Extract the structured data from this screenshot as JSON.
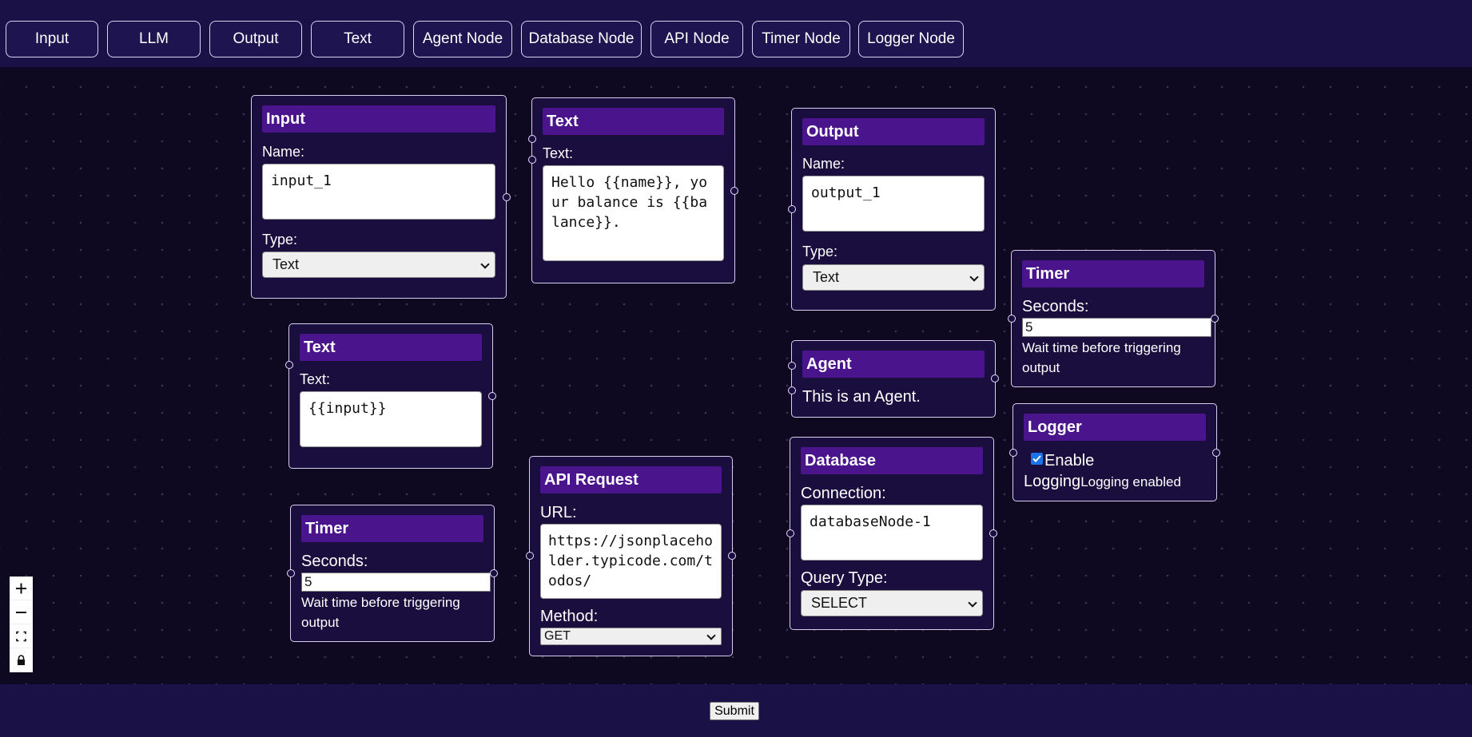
{
  "toolbar": {
    "buttons": [
      "Input",
      "LLM",
      "Output",
      "Text",
      "Agent Node",
      "Database Node",
      "API Node",
      "Timer Node",
      "Logger Node"
    ]
  },
  "nodes": {
    "input": {
      "title": "Input",
      "name_label": "Name:",
      "name_value": "input_1",
      "type_label": "Type:",
      "type_value": "Text"
    },
    "text_top": {
      "title": "Text",
      "text_label": "Text:",
      "text_value": "Hello {{name}}, your balance is {{balance}}."
    },
    "output": {
      "title": "Output",
      "name_label": "Name:",
      "name_value": "output_1",
      "type_label": "Type:",
      "type_value": "Text"
    },
    "text_mid": {
      "title": "Text",
      "text_label": "Text:",
      "text_value": "{{input}}"
    },
    "agent": {
      "title": "Agent",
      "body": "This is an Agent."
    },
    "timer_right": {
      "title": "Timer",
      "seconds_label": "Seconds:",
      "seconds_value": "5",
      "hint": "Wait time before triggering output"
    },
    "logger": {
      "title": "Logger",
      "checkbox_label": "Enable",
      "logging_word": "Logging",
      "status": "Logging enabled",
      "enabled": true
    },
    "timer_left": {
      "title": "Timer",
      "seconds_label": "Seconds:",
      "seconds_value": "5",
      "hint": "Wait time before triggering output"
    },
    "api": {
      "title": "API Request",
      "url_label": "URL:",
      "url_value": "https://jsonplaceholder.typicode.com/todos/",
      "method_label": "Method:",
      "method_value": "GET"
    },
    "database": {
      "title": "Database",
      "connection_label": "Connection:",
      "connection_value": "databaseNode-1",
      "query_label": "Query Type:",
      "query_value": "SELECT"
    }
  },
  "zoom_controls": [
    "zoom-in-icon",
    "zoom-out-icon",
    "fit-view-icon",
    "lock-icon"
  ],
  "footer": {
    "submit_label": "Submit"
  },
  "colors": {
    "page_bg": "#0e0821",
    "toolbar_bg": "#1a1146",
    "node_bg": "#1a0e3e",
    "node_header": "#4a148c",
    "checkbox": "#1a73e8"
  }
}
